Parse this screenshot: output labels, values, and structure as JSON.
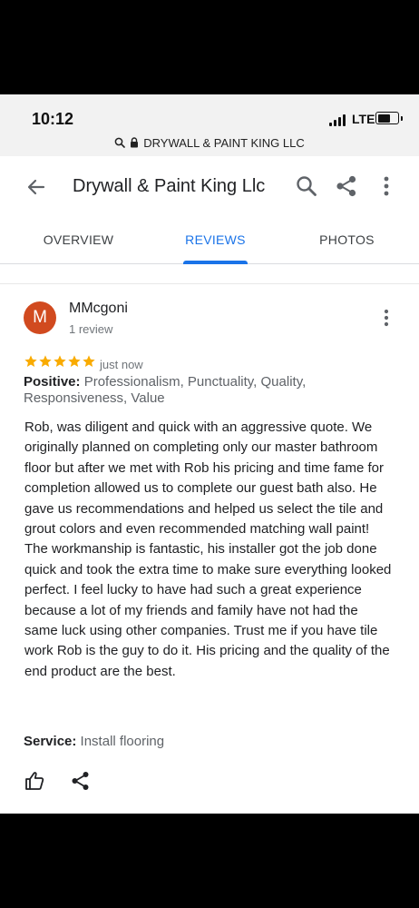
{
  "status_bar": {
    "time": "10:12",
    "network": "LTE",
    "url": "DRYWALL & PAINT KING LLC"
  },
  "header": {
    "title": "Drywall & Paint King Llc"
  },
  "tabs": [
    {
      "label": "OVERVIEW",
      "active": false
    },
    {
      "label": "REVIEWS",
      "active": true
    },
    {
      "label": "PHOTOS",
      "active": false
    }
  ],
  "review": {
    "avatar_letter": "M",
    "reviewer_name": "MMcgoni",
    "review_count": "1 review",
    "rating": 5,
    "date": "just now",
    "positive_label": "Positive:",
    "positive_text": "Professionalism, Punctuality, Quality, Responsiveness, Value",
    "body": "Rob, was diligent and quick with an aggressive quote. We originally planned on completing only our master bathroom floor but after we met with Rob his pricing and time fame for completion allowed us to complete our guest bath also. He gave us recommendations and helped us select the tile and grout colors and even recommended matching wall paint! The workmanship is fantastic, his installer got the job done quick and took the extra time to make sure everything looked perfect. I feel lucky to have had such a great experience because a lot of my friends and family have not had the same luck using other companies. Trust me if you have tile work Rob is the guy to do it. His pricing and the quality of the end product are the best.",
    "service_label": "Service:",
    "service_text": "Install flooring"
  },
  "colors": {
    "accent": "#1a73e8",
    "avatar": "#d14a1f",
    "star": "#f9ab00"
  },
  "icons": {
    "back": "arrow-back-icon",
    "search": "search-icon",
    "share": "share-icon",
    "more": "more-vert-icon",
    "like": "thumb-up-icon",
    "lock": "lock-icon"
  }
}
